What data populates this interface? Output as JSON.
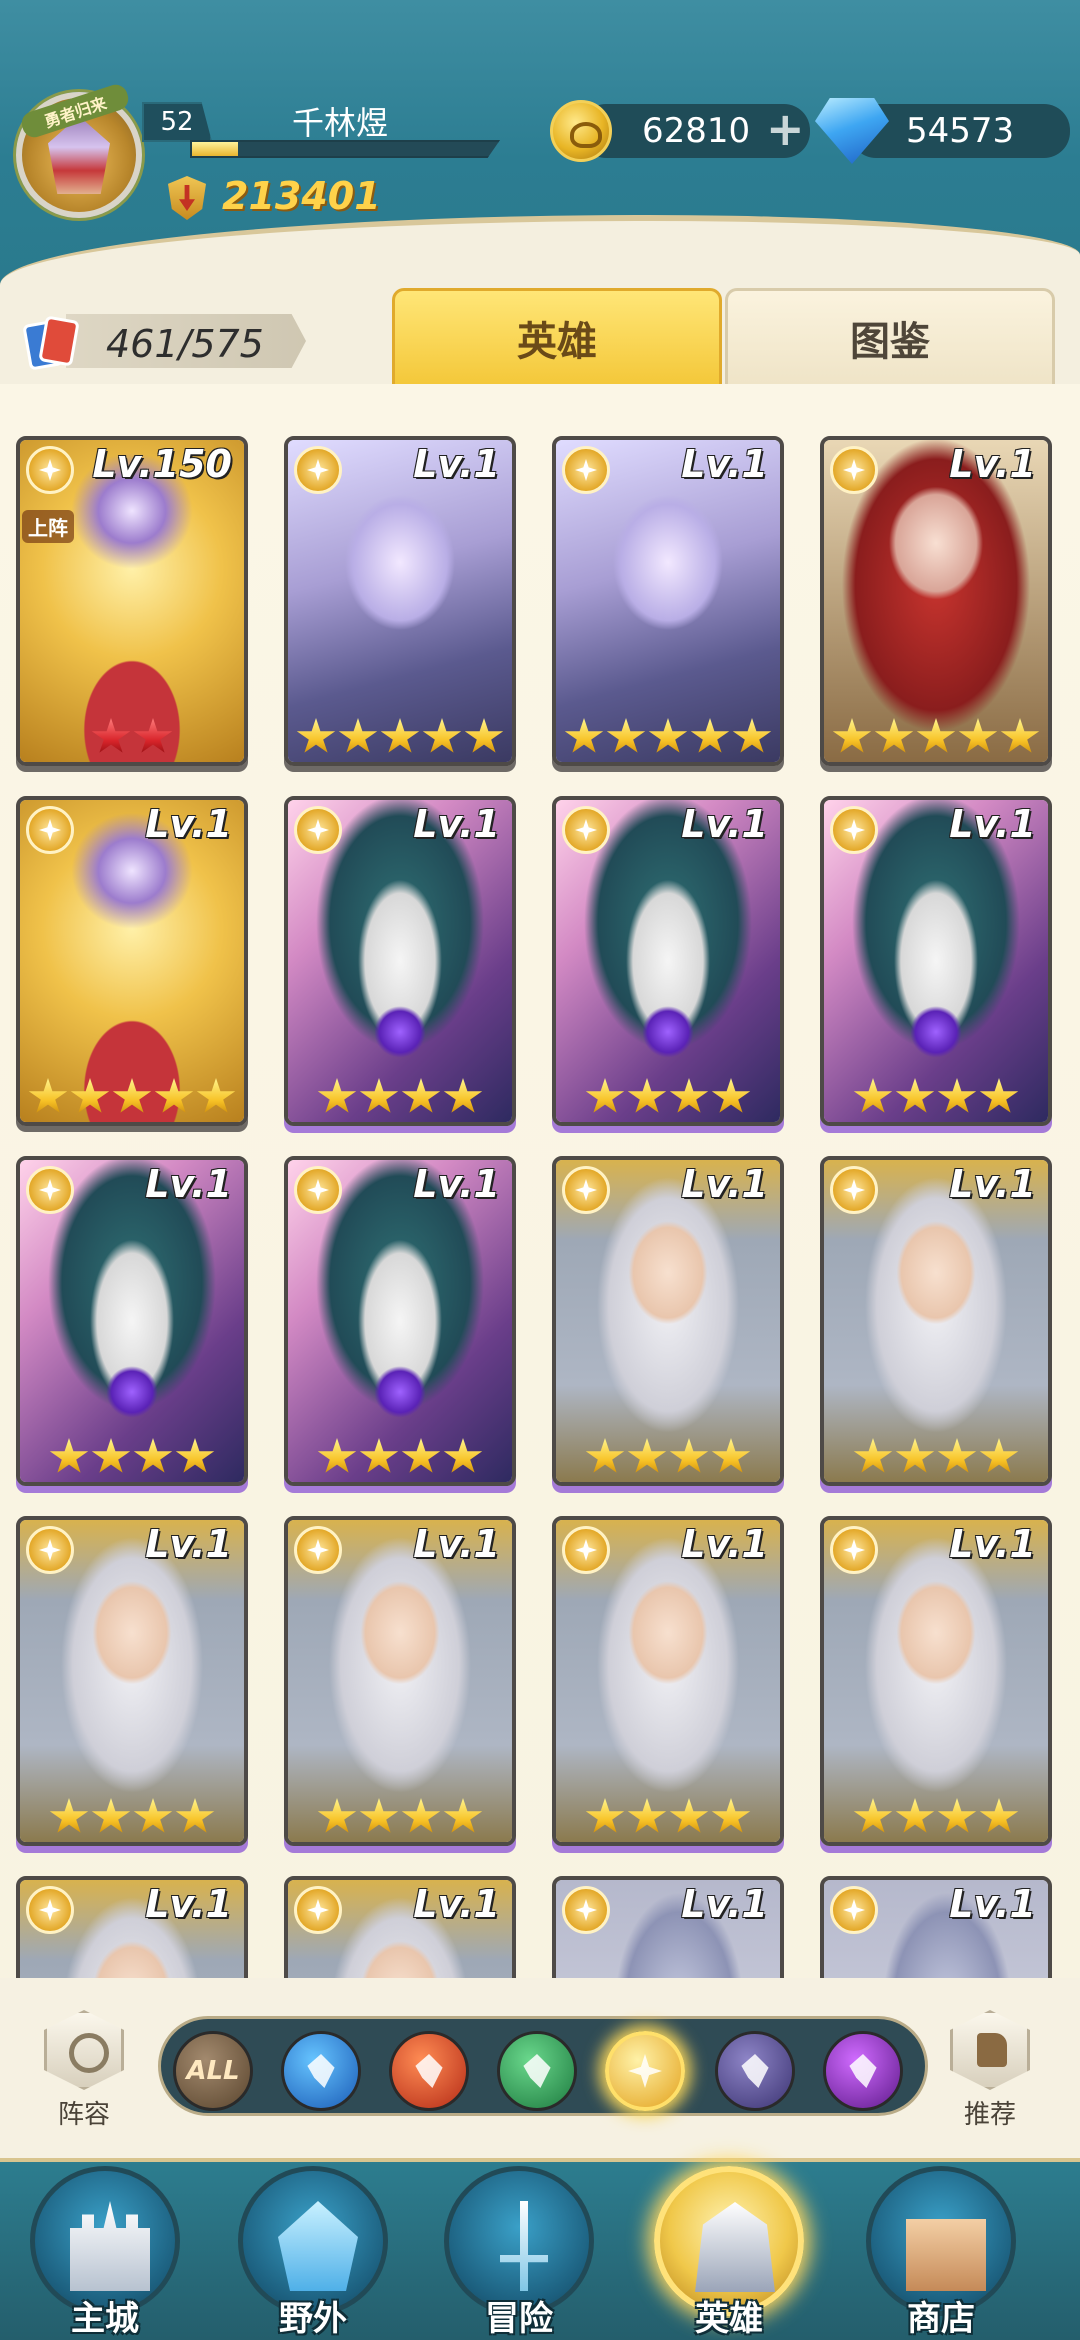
{
  "player": {
    "level": "52",
    "name": "千林煜",
    "exp_fraction": 0.15,
    "power": "213401",
    "avatar_ribbon": "勇者归来"
  },
  "currencies": {
    "gold": {
      "icon": "gold-coin-icon",
      "value": "62810",
      "plus": "+"
    },
    "gems": {
      "icon": "diamond-icon",
      "value": "54573",
      "plus": "+"
    }
  },
  "hero_count": "461/575",
  "tabs": [
    {
      "label": "英雄",
      "active": true
    },
    {
      "label": "图鉴",
      "active": false
    }
  ],
  "heroes": [
    {
      "level": "Lv.150",
      "art": "gold",
      "stars": 2,
      "star_color": "red",
      "tag": "上阵",
      "frame": "gray"
    },
    {
      "level": "Lv.1",
      "art": "elf",
      "stars": 5,
      "star_color": "gold",
      "frame": "gray"
    },
    {
      "level": "Lv.1",
      "art": "elf",
      "stars": 5,
      "star_color": "gold",
      "frame": "gray"
    },
    {
      "level": "Lv.1",
      "art": "red",
      "stars": 5,
      "star_color": "gold",
      "frame": "gray"
    },
    {
      "level": "Lv.1",
      "art": "gold",
      "stars": 5,
      "star_color": "gold",
      "frame": "gray"
    },
    {
      "level": "Lv.1",
      "art": "wizard",
      "stars": 4,
      "star_color": "gold",
      "frame": "purple"
    },
    {
      "level": "Lv.1",
      "art": "wizard",
      "stars": 4,
      "star_color": "gold",
      "frame": "purple"
    },
    {
      "level": "Lv.1",
      "art": "wizard",
      "stars": 4,
      "star_color": "gold",
      "frame": "purple"
    },
    {
      "level": "Lv.1",
      "art": "wizard",
      "stars": 4,
      "star_color": "gold",
      "frame": "purple"
    },
    {
      "level": "Lv.1",
      "art": "wizard",
      "stars": 4,
      "star_color": "gold",
      "frame": "purple"
    },
    {
      "level": "Lv.1",
      "art": "priestess",
      "stars": 4,
      "star_color": "gold",
      "frame": "purple"
    },
    {
      "level": "Lv.1",
      "art": "priestess",
      "stars": 4,
      "star_color": "gold",
      "frame": "purple"
    },
    {
      "level": "Lv.1",
      "art": "priestess",
      "stars": 4,
      "star_color": "gold",
      "frame": "purple"
    },
    {
      "level": "Lv.1",
      "art": "priestess",
      "stars": 4,
      "star_color": "gold",
      "frame": "purple"
    },
    {
      "level": "Lv.1",
      "art": "priestess",
      "stars": 4,
      "star_color": "gold",
      "frame": "purple"
    },
    {
      "level": "Lv.1",
      "art": "priestess",
      "stars": 4,
      "star_color": "gold",
      "frame": "purple"
    },
    {
      "level": "Lv.1",
      "art": "priestess",
      "stars": 0,
      "star_color": "gold",
      "frame": "gray"
    },
    {
      "level": "Lv.1",
      "art": "priestess",
      "stars": 0,
      "star_color": "gold",
      "frame": "gray"
    },
    {
      "level": "Lv.1",
      "art": "knight",
      "stars": 0,
      "star_color": "gold",
      "frame": "gray"
    },
    {
      "level": "Lv.1",
      "art": "knight",
      "stars": 0,
      "star_color": "gold",
      "frame": "gray"
    }
  ],
  "filters": {
    "lineup_label": "阵容",
    "recommend_label": "推荐",
    "elements": [
      {
        "name": "all",
        "label": "ALL",
        "active": false
      },
      {
        "name": "water",
        "label": "",
        "active": false
      },
      {
        "name": "fire",
        "label": "",
        "active": false
      },
      {
        "name": "wind",
        "label": "",
        "active": false
      },
      {
        "name": "light",
        "label": "",
        "active": true
      },
      {
        "name": "dark",
        "label": "",
        "active": false
      },
      {
        "name": "void",
        "label": "",
        "active": false
      }
    ]
  },
  "nav": [
    {
      "label": "主城",
      "icon": "castle",
      "active": false
    },
    {
      "label": "野外",
      "icon": "portal",
      "active": false
    },
    {
      "label": "冒险",
      "icon": "sword",
      "active": false
    },
    {
      "label": "英雄",
      "icon": "helmet",
      "active": true
    },
    {
      "label": "商店",
      "icon": "shop",
      "active": false
    }
  ]
}
